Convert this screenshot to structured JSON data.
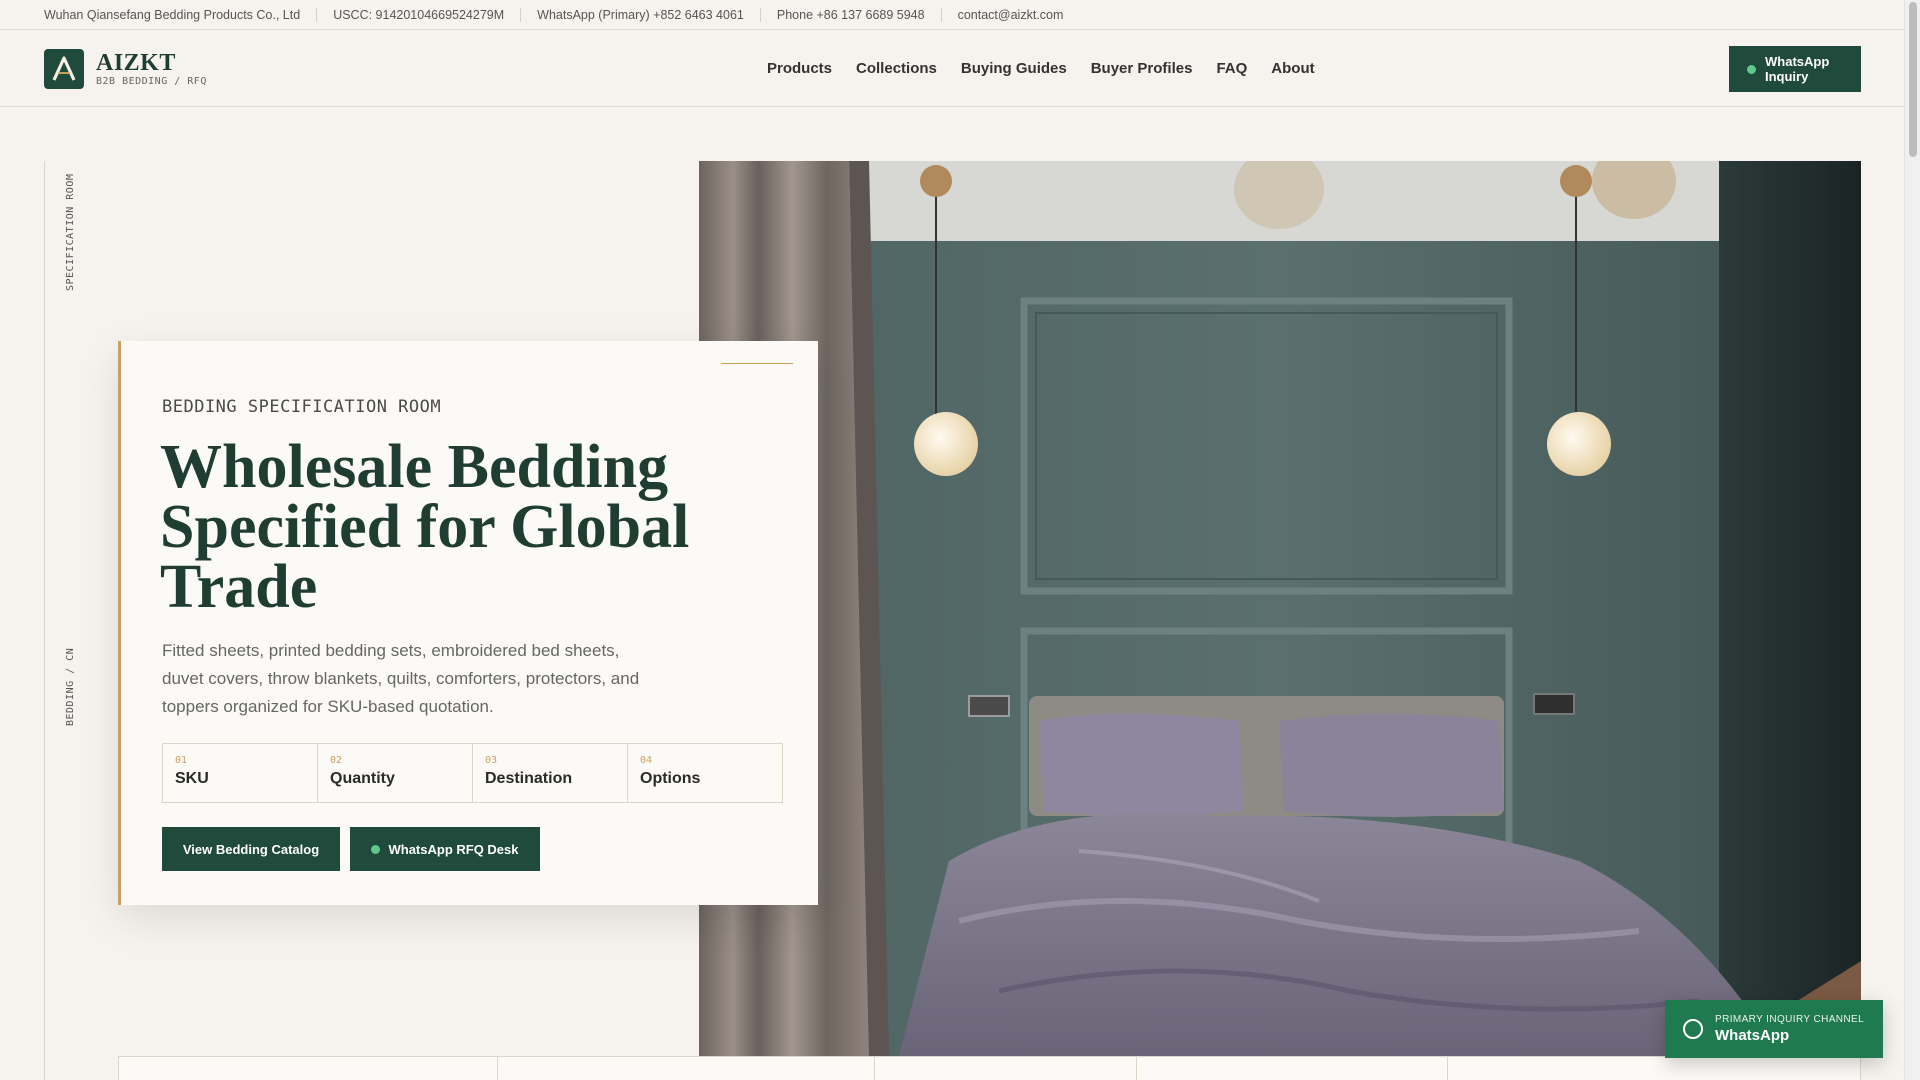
{
  "topbar": {
    "company": "Wuhan Qiansefang Bedding Products Co., Ltd",
    "uscc": "USCC: 91420104669524279M",
    "whatsapp": "WhatsApp (Primary) +852 6463 4061",
    "phone": "Phone +86 137 6689 5948",
    "email": "contact@aizkt.com"
  },
  "header": {
    "brand": "AIZKT",
    "tagline": "B2B BEDDING / RFQ",
    "nav": [
      "Products",
      "Collections",
      "Buying Guides",
      "Buyer Profiles",
      "FAQ",
      "About"
    ],
    "cta": "WhatsApp Inquiry"
  },
  "rail": {
    "top_label": "SPECIFICATION ROOM",
    "bottom_label": "BEDDING / CN"
  },
  "hero": {
    "eyebrow": "BEDDING SPECIFICATION ROOM",
    "headline": "Wholesale Bedding Specified for Global Trade",
    "lead": "Fitted sheets, printed bedding sets, embroidered bed sheets, duvet covers, throw blankets, quilts, comforters, protectors, and toppers organized for SKU-based quotation.",
    "steps": [
      {
        "num": "01",
        "label": "SKU"
      },
      {
        "num": "02",
        "label": "Quantity"
      },
      {
        "num": "03",
        "label": "Destination"
      },
      {
        "num": "04",
        "label": "Options"
      }
    ],
    "primary_button": "View Bedding Catalog",
    "secondary_button": "WhatsApp RFQ Desk"
  },
  "floating": {
    "small": "PRIMARY INQUIRY CHANNEL",
    "big": "WhatsApp"
  },
  "colors": {
    "brand_green": "#1f4a3c",
    "accent_gold": "#c9a15f",
    "whatsapp_green": "#1f7a50",
    "background": "#f6f3ee"
  }
}
